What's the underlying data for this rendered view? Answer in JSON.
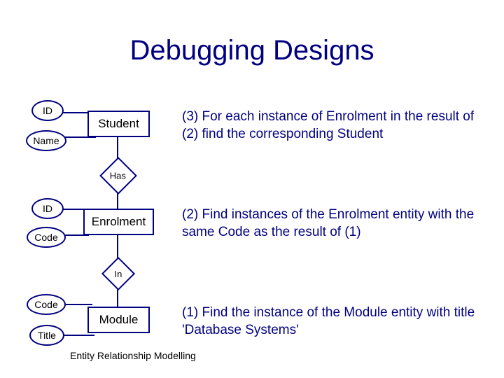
{
  "title": "Debugging Designs",
  "entities": {
    "student": "Student",
    "enrolment": "Enrolment",
    "module": "Module"
  },
  "attributes": {
    "student_id": "ID",
    "student_name": "Name",
    "enrolment_id": "ID",
    "enrolment_code": "Code",
    "module_code": "Code",
    "module_title": "Title"
  },
  "relationships": {
    "has": "Has",
    "in": "In"
  },
  "steps": {
    "s3": "(3) For each instance of Enrolment in the result of (2) find the corresponding Student",
    "s2": "(2) Find instances of the Enrolment entity with the same Code as the result of (1)",
    "s1": "(1) Find the instance of the Module entity with title 'Database Systems'"
  },
  "footer": "Entity Relationship Modelling"
}
